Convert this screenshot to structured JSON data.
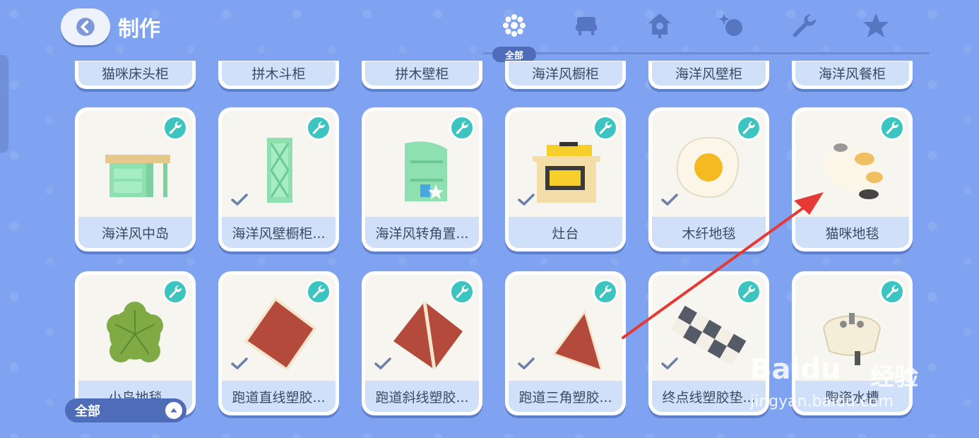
{
  "header": {
    "title": "制作",
    "active_tab_label": "全部",
    "tabs": [
      {
        "icon": "grid-dots-icon"
      },
      {
        "icon": "armchair-icon"
      },
      {
        "icon": "cuckoo-clock-icon"
      },
      {
        "icon": "sparkle-ball-icon"
      },
      {
        "icon": "wrench-icon"
      },
      {
        "icon": "star-icon"
      }
    ]
  },
  "top_row": [
    "猫咪床头柜",
    "拼木斗柜",
    "拼木壁柜",
    "海洋风橱柜",
    "海洋风壁柜",
    "海洋风餐柜"
  ],
  "row1": [
    {
      "label": "海洋风中岛",
      "owned": false
    },
    {
      "label": "海洋风壁橱柜...",
      "owned": true
    },
    {
      "label": "海洋风转角置...",
      "owned": false
    },
    {
      "label": "灶台",
      "owned": true
    },
    {
      "label": "木纤地毯",
      "owned": true
    },
    {
      "label": "猫咪地毯",
      "owned": false
    }
  ],
  "row2": [
    {
      "label": "小鸟地毯",
      "owned": false
    },
    {
      "label": "跑道直线塑胶...",
      "owned": true
    },
    {
      "label": "跑道斜线塑胶...",
      "owned": true
    },
    {
      "label": "跑道三角塑胶...",
      "owned": true
    },
    {
      "label": "终点线塑胶垫...",
      "owned": true
    },
    {
      "label": "陶瓷水槽",
      "owned": false
    }
  ],
  "filter": {
    "label": "全部"
  },
  "watermark": {
    "logo": "Baidu",
    "cn": "经验",
    "url": "jingyan.baidu.com"
  },
  "colors": {
    "background": "#7fa3f0",
    "badge": "#3cc4c0",
    "label_bg": "#cfe0f8",
    "arrow": "#e53935"
  }
}
